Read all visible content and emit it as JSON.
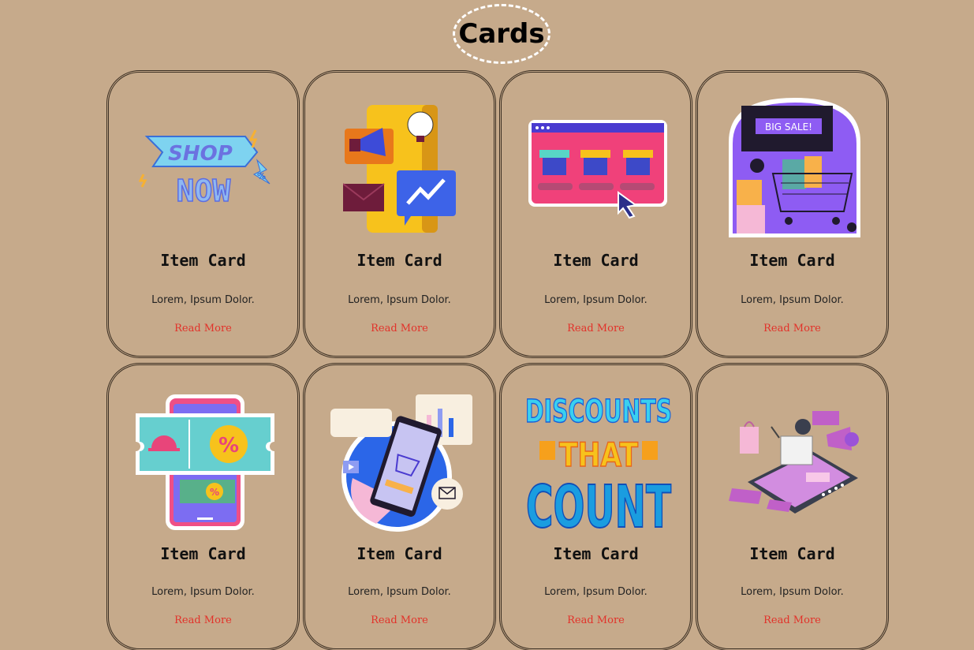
{
  "page": {
    "title": "Cards"
  },
  "cards": [
    {
      "title": "Item Card",
      "text": "Lorem, Ipsum Dolor.",
      "link": "Read More",
      "icon": "shop-now-illustration"
    },
    {
      "title": "Item Card",
      "text": "Lorem, Ipsum Dolor.",
      "link": "Read More",
      "icon": "marketing-phone-illustration"
    },
    {
      "title": "Item Card",
      "text": "Lorem, Ipsum Dolor.",
      "link": "Read More",
      "icon": "online-stores-illustration"
    },
    {
      "title": "Item Card",
      "text": "Lorem, Ipsum Dolor.",
      "link": "Read More",
      "icon": "big-sale-cart-illustration",
      "image_text": "BIG SALE!"
    },
    {
      "title": "Item Card",
      "text": "Lorem, Ipsum Dolor.",
      "link": "Read More",
      "icon": "discount-coupon-phone-illustration"
    },
    {
      "title": "Item Card",
      "text": "Lorem, Ipsum Dolor.",
      "link": "Read More",
      "icon": "mobile-shopping-illustration"
    },
    {
      "title": "Item Card",
      "text": "Lorem, Ipsum Dolor.",
      "link": "Read More",
      "icon": "discounts-that-count-illustration",
      "image_text": "DISCOUNTS THAT COUNT"
    },
    {
      "title": "Item Card",
      "text": "Lorem, Ipsum Dolor.",
      "link": "Read More",
      "icon": "ecommerce-isometric-illustration"
    }
  ],
  "colors": {
    "background": "#c6aa8b",
    "link": "#e2322a",
    "border": "#3a2e22"
  }
}
